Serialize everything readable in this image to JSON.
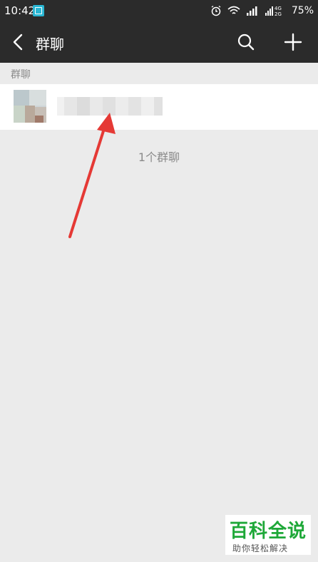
{
  "status_bar": {
    "time": "10:42",
    "network": "4G 2G",
    "battery": "75%"
  },
  "header": {
    "title": "群聊",
    "back_icon": "chevron-left-icon",
    "search_icon": "search-icon",
    "add_icon": "plus-icon"
  },
  "list": {
    "section_label": "群聊",
    "items": [
      {
        "name": "",
        "avatar": "group-avatar"
      }
    ],
    "footer_count": "1个群聊"
  },
  "watermark": {
    "title": "百科全说",
    "subtitle": "助你轻松解决"
  },
  "colors": {
    "header_bg": "#2b2b2b",
    "page_bg": "#ebebeb",
    "arrow": "#e53935",
    "watermark_green": "#1ea838"
  }
}
